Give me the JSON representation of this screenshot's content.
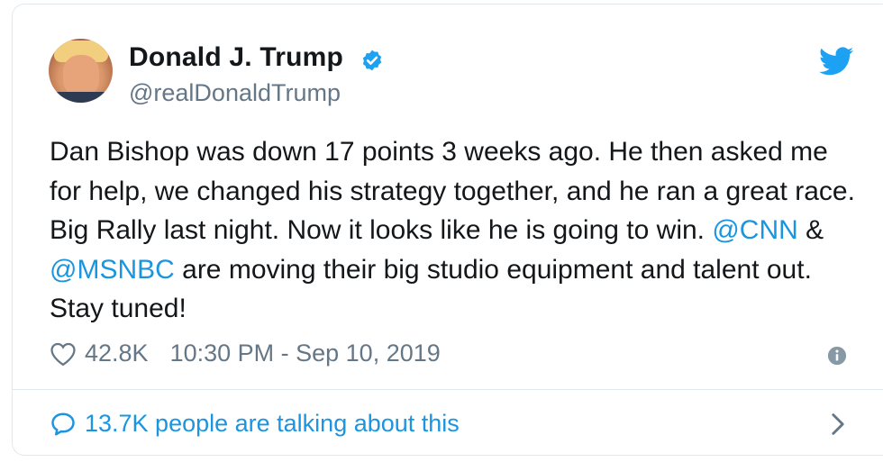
{
  "tweet": {
    "author_name": "Donald J. Trump",
    "handle": "@realDonaldTrump",
    "body": [
      {
        "text": "Dan Bishop was down 17 points 3 weeks ago. He then asked me for help, we changed his strategy together, and he ran a great race. Big Rally last night. Now it looks like he is going to win. "
      },
      {
        "text": "@CNN",
        "mention": true
      },
      {
        "text": " & "
      },
      {
        "text": "@MSNBC",
        "mention": true
      },
      {
        "text": " are moving their big studio equipment and talent out. Stay tuned!"
      }
    ],
    "likes": "42.8K",
    "timestamp": "10:30 PM - Sep 10, 2019",
    "talking": "13.7K people are talking about this"
  },
  "icons": {
    "avatar": "avatar-photo",
    "verified": "verified-badge-icon",
    "brand": "twitter-bird-icon",
    "like": "heart-icon",
    "info": "info-icon",
    "talking": "speech-bubble-icon",
    "chevron": "chevron-right-icon"
  },
  "colors": {
    "text": "#14171a",
    "secondary": "#657786",
    "accent": "#1b95e0",
    "divider": "#e1e8ed"
  }
}
